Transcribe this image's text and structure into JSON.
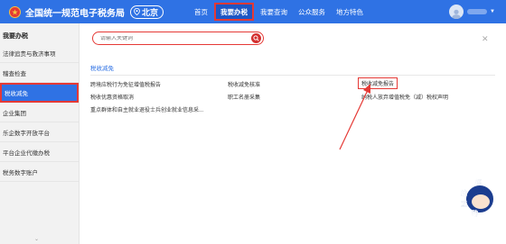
{
  "header": {
    "site_title": "全国统一规范电子税务局",
    "location": "北京",
    "nav": [
      "首页",
      "我要办税",
      "我要查询",
      "公众服务",
      "地方特色"
    ],
    "active_nav": "我要办税"
  },
  "sidebar": {
    "title": "我要办税",
    "items": [
      "法律追责与救济事项",
      "稽查检查",
      "税收减免",
      "企业集团",
      "乐企数字开放平台",
      "平台企业代缴办税",
      "税务数字账户"
    ],
    "active_item": "税收减免",
    "more": "⌄"
  },
  "main": {
    "search_placeholder": "请输入关键词",
    "section_label": "税收减免",
    "links": {
      "col1": [
        "跨境应税行为免征增值税报告",
        "税收优惠资格取消",
        "重点群体和自主就业退役士兵创业就业信息采..."
      ],
      "col2": [
        "税收减免核准",
        "职工名册采集"
      ],
      "col3": [
        "税收减免报告",
        "纳税人放弃增值税免（减）税权声明"
      ]
    },
    "highlighted_link": "税收减免报告"
  },
  "mascot": {
    "chars": [
      "征",
      "纳",
      "互",
      "动"
    ]
  },
  "colors": {
    "header_blue": "#2f72e4",
    "highlight_red": "#e53935"
  }
}
